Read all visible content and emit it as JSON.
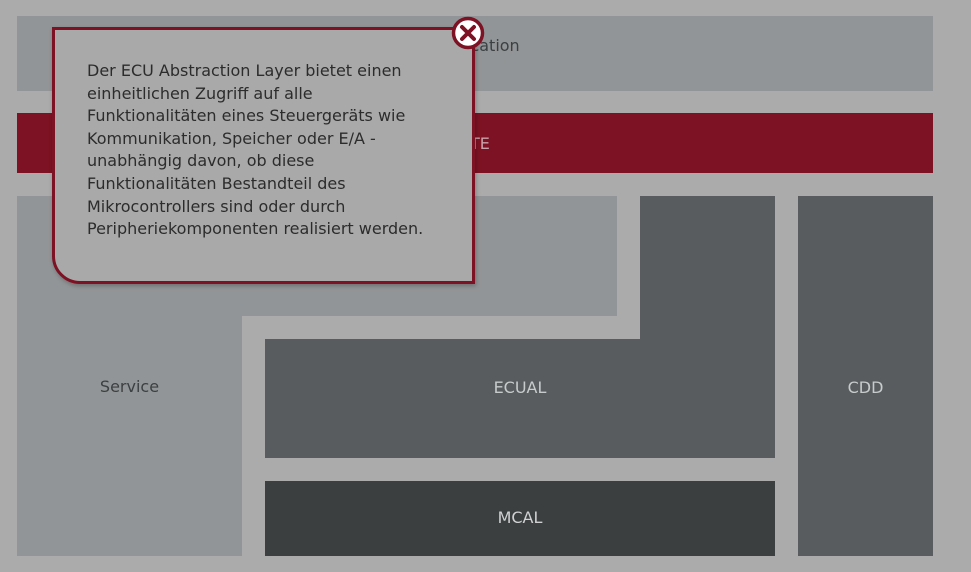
{
  "blocks": {
    "application": "Application",
    "rte": "RTE",
    "service": "Service",
    "ecual": "ECUAL",
    "mcal": "MCAL",
    "cdd": "CDD"
  },
  "popup": {
    "text": "Der ECU Abstraction Layer bietet einen\neinheitlichen Zugriff auf alle\nFunktionalitäten eines Steuergeräts wie\nKommunikation, Speicher oder E/A -\nunabhängig davon, ob diese\nFunktionalitäten Bestandteil des\nMikrocontrollers sind oder durch\nPeripheriekomponenten realisiert werden.",
    "close_icon": "close-circle-x-icon"
  },
  "colors": {
    "accent": "#7c1223",
    "background": "#ababab"
  }
}
